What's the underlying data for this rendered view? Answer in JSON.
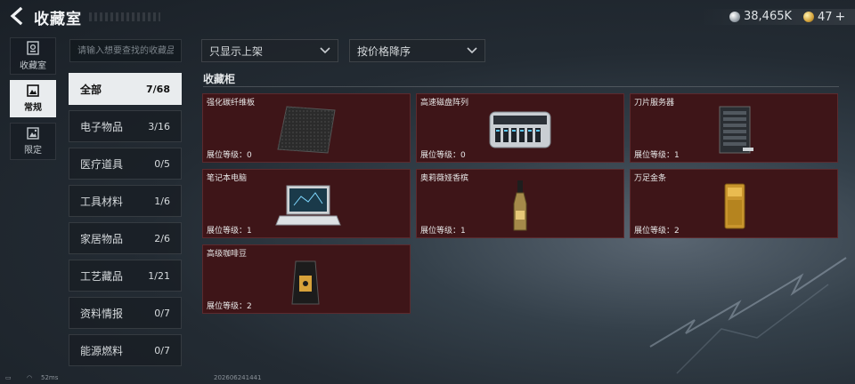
{
  "header": {
    "title": "收藏室",
    "silver_amount": "38,465K",
    "gold_amount": "47",
    "gold_plus": "+"
  },
  "nav": [
    {
      "label": "收藏室",
      "icon": "collection-room-icon"
    },
    {
      "label": "常规",
      "icon": "picture-frame-icon"
    },
    {
      "label": "限定",
      "icon": "limited-frame-icon"
    }
  ],
  "search": {
    "placeholder": "请输入想要查找的收藏品"
  },
  "categories": [
    {
      "label": "全部",
      "count": "7/68"
    },
    {
      "label": "电子物品",
      "count": "3/16"
    },
    {
      "label": "医疗道具",
      "count": "0/5"
    },
    {
      "label": "工具材料",
      "count": "1/6"
    },
    {
      "label": "家居物品",
      "count": "2/6"
    },
    {
      "label": "工艺藏品",
      "count": "1/21"
    },
    {
      "label": "资料情报",
      "count": "0/7"
    },
    {
      "label": "能源燃料",
      "count": "0/7"
    }
  ],
  "filters": {
    "shelf": "只显示上架",
    "sort": "按价格降序"
  },
  "section": {
    "title": "收藏柜"
  },
  "items": [
    {
      "name": "强化碳纤维板",
      "level_text": "展位等级：0",
      "icon": "carbon-fiber-plate-icon"
    },
    {
      "name": "高速磁盘阵列",
      "level_text": "展位等级：0",
      "icon": "disk-array-icon"
    },
    {
      "name": "刀片服务器",
      "level_text": "展位等级：1",
      "icon": "blade-server-icon"
    },
    {
      "name": "笔记本电脑",
      "level_text": "展位等级：1",
      "icon": "laptop-icon"
    },
    {
      "name": "奥莉薇娅香槟",
      "level_text": "展位等级：1",
      "icon": "champagne-bottle-icon"
    },
    {
      "name": "万足金条",
      "level_text": "展位等级：2",
      "icon": "gold-bar-icon"
    },
    {
      "name": "高级咖啡豆",
      "level_text": "展位等级：2",
      "icon": "coffee-bean-bag-icon"
    }
  ],
  "footer": {
    "ping": "52ms",
    "build": "20260624144​1"
  },
  "colors": {
    "card_bg": "#3e1518",
    "active_tab_bg": "#e9ecee",
    "accent_gold": "#d3a23a"
  }
}
